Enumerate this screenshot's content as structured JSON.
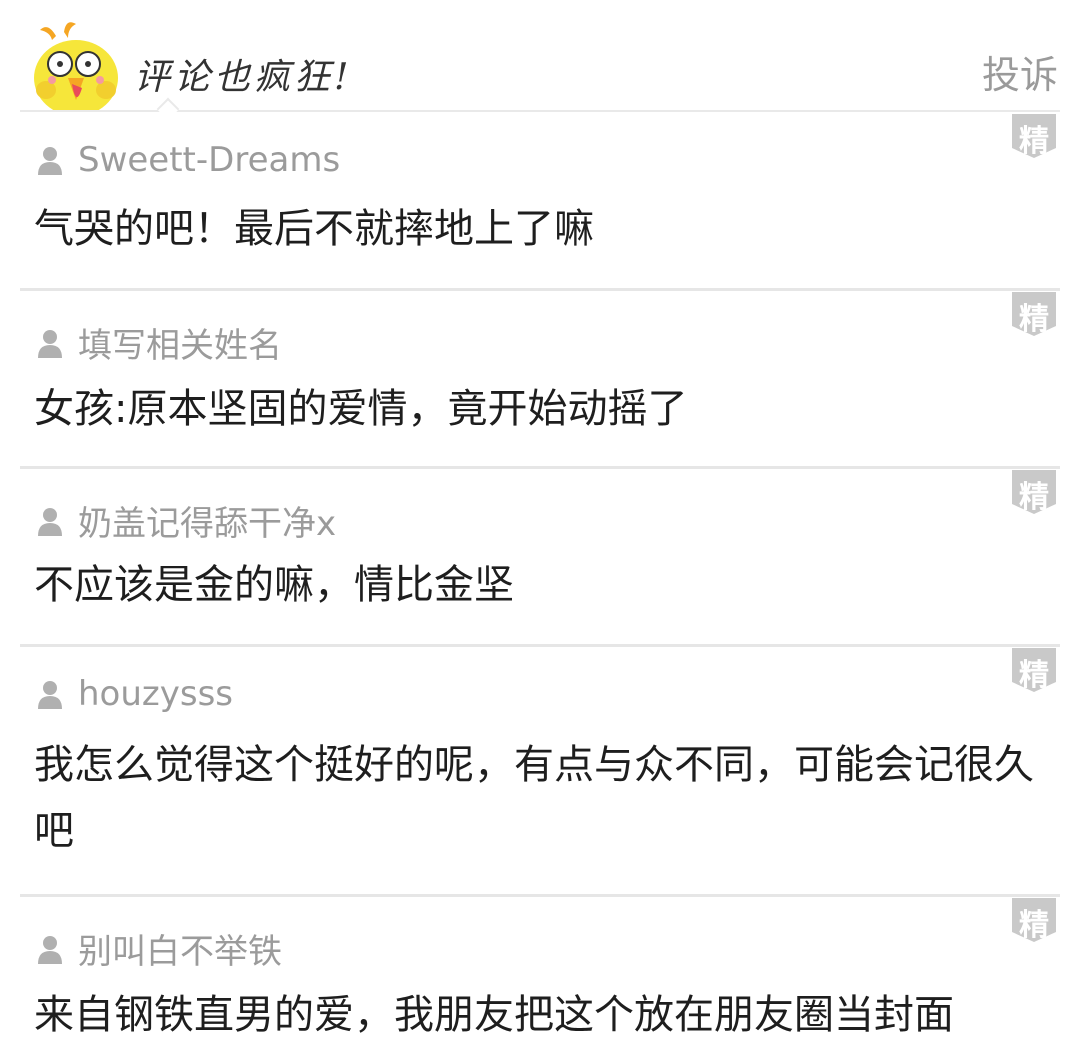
{
  "header": {
    "title": "评论也疯狂!",
    "report_label": "投诉"
  },
  "comments": [
    {
      "user": "Sweett-Dreams",
      "text": "气哭的吧！最后不就摔地上了嘛",
      "badge": "精"
    },
    {
      "user": "填写相关姓名",
      "text": "女孩:原本坚固的爱情，竟开始动摇了",
      "badge": "精"
    },
    {
      "user": "奶盖记得舔干净x",
      "text": "不应该是金的嘛，情比金坚",
      "badge": "精"
    },
    {
      "user": "houzysss",
      "text": "我怎么觉得这个挺好的呢，有点与众不同，可能会记很久吧",
      "badge": "精"
    },
    {
      "user": "别叫白不举铁",
      "text": "来自钢铁直男的爱，我朋友把这个放在朋友圈当封面",
      "badge": "精"
    }
  ],
  "colors": {
    "badge_bg": "#c9c9c9",
    "username": "#9b9b9b",
    "mascot_yellow": "#f6e63a",
    "mascot_orange": "#f5a623"
  },
  "icons": {
    "mascot": "mascot-chick-icon",
    "user": "user-icon",
    "badge": "featured-badge-icon"
  }
}
